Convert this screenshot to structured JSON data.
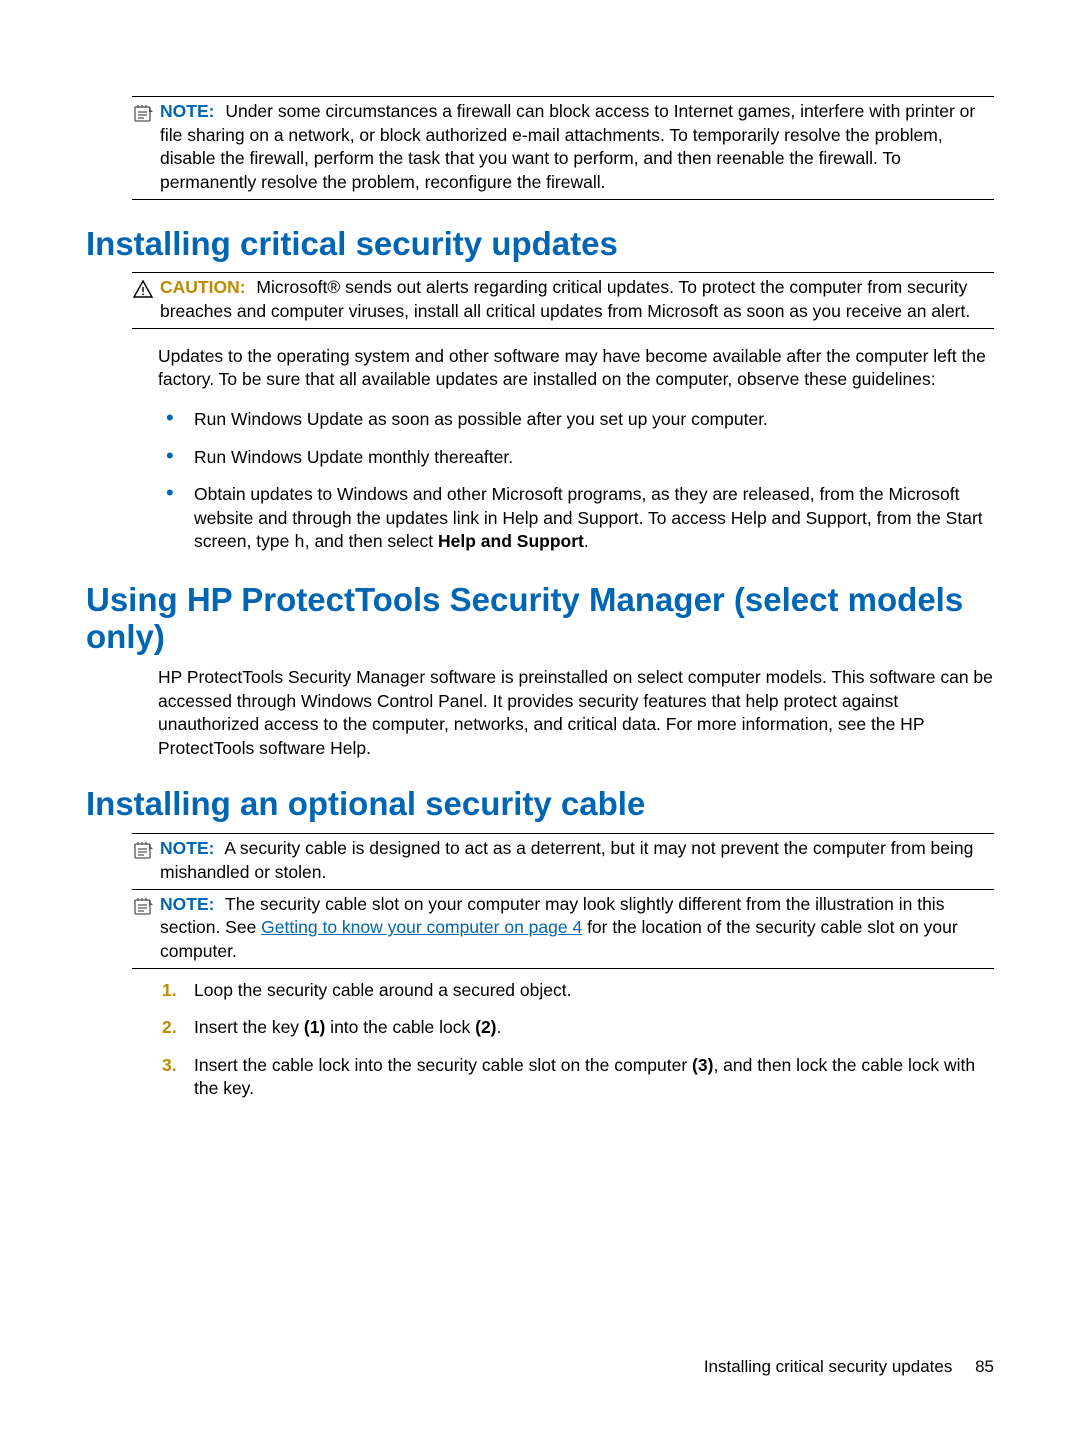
{
  "callout_note1": {
    "lead": "NOTE:",
    "text": "Under some circumstances a firewall can block access to Internet games, interfere with printer or file sharing on a network, or block authorized e-mail attachments. To temporarily resolve the problem, disable the firewall, perform the task that you want to perform, and then reenable the firewall. To permanently resolve the problem, reconfigure the firewall."
  },
  "heading_updates": "Installing critical security updates",
  "callout_caution": {
    "lead": "CAUTION:",
    "text": "Microsoft® sends out alerts regarding critical updates. To protect the computer from security breaches and computer viruses, install all critical updates from Microsoft as soon as you receive an alert."
  },
  "updates_para": "Updates to the operating system and other software may have become available after the computer left the factory. To be sure that all available updates are installed on the computer, observe these guidelines:",
  "bullets": {
    "b1": "Run Windows Update as soon as possible after you set up your computer.",
    "b2": "Run Windows Update monthly thereafter.",
    "b3_pre": "Obtain updates to Windows and other Microsoft programs, as they are released, from the Microsoft website and through the updates link in Help and Support. To access Help and Support, from the Start screen, type ",
    "b3_mono": "h",
    "b3_mid": ", and then select ",
    "b3_bold": "Help and Support",
    "b3_end": "."
  },
  "heading_protecttools": "Using HP ProtectTools Security Manager (select models only)",
  "protecttools_para": "HP ProtectTools Security Manager software is preinstalled on select computer models. This software can be accessed through Windows Control Panel. It provides security features that help protect against unauthorized access to the computer, networks, and critical data. For more information, see the HP ProtectTools software Help.",
  "heading_cable": "Installing an optional security cable",
  "callout_note2": {
    "lead": "NOTE:",
    "text": "A security cable is designed to act as a deterrent, but it may not prevent the computer from being mishandled or stolen."
  },
  "callout_note3": {
    "lead": "NOTE:",
    "pre": "The security cable slot on your computer may look slightly different from the illustration in this section. See ",
    "link": "Getting to know your computer on page 4",
    "post": " for the location of the security cable slot on your computer."
  },
  "steps": {
    "s1": "Loop the security cable around a secured object.",
    "s2_pre": "Insert the key ",
    "s2_b1": "(1)",
    "s2_mid": " into the cable lock ",
    "s2_b2": "(2)",
    "s2_end": ".",
    "s3_pre": "Insert the cable lock into the security cable slot on the computer ",
    "s3_b1": "(3)",
    "s3_post": ", and then lock the cable lock with the key."
  },
  "footer": {
    "title": "Installing critical security updates",
    "page": "85"
  }
}
